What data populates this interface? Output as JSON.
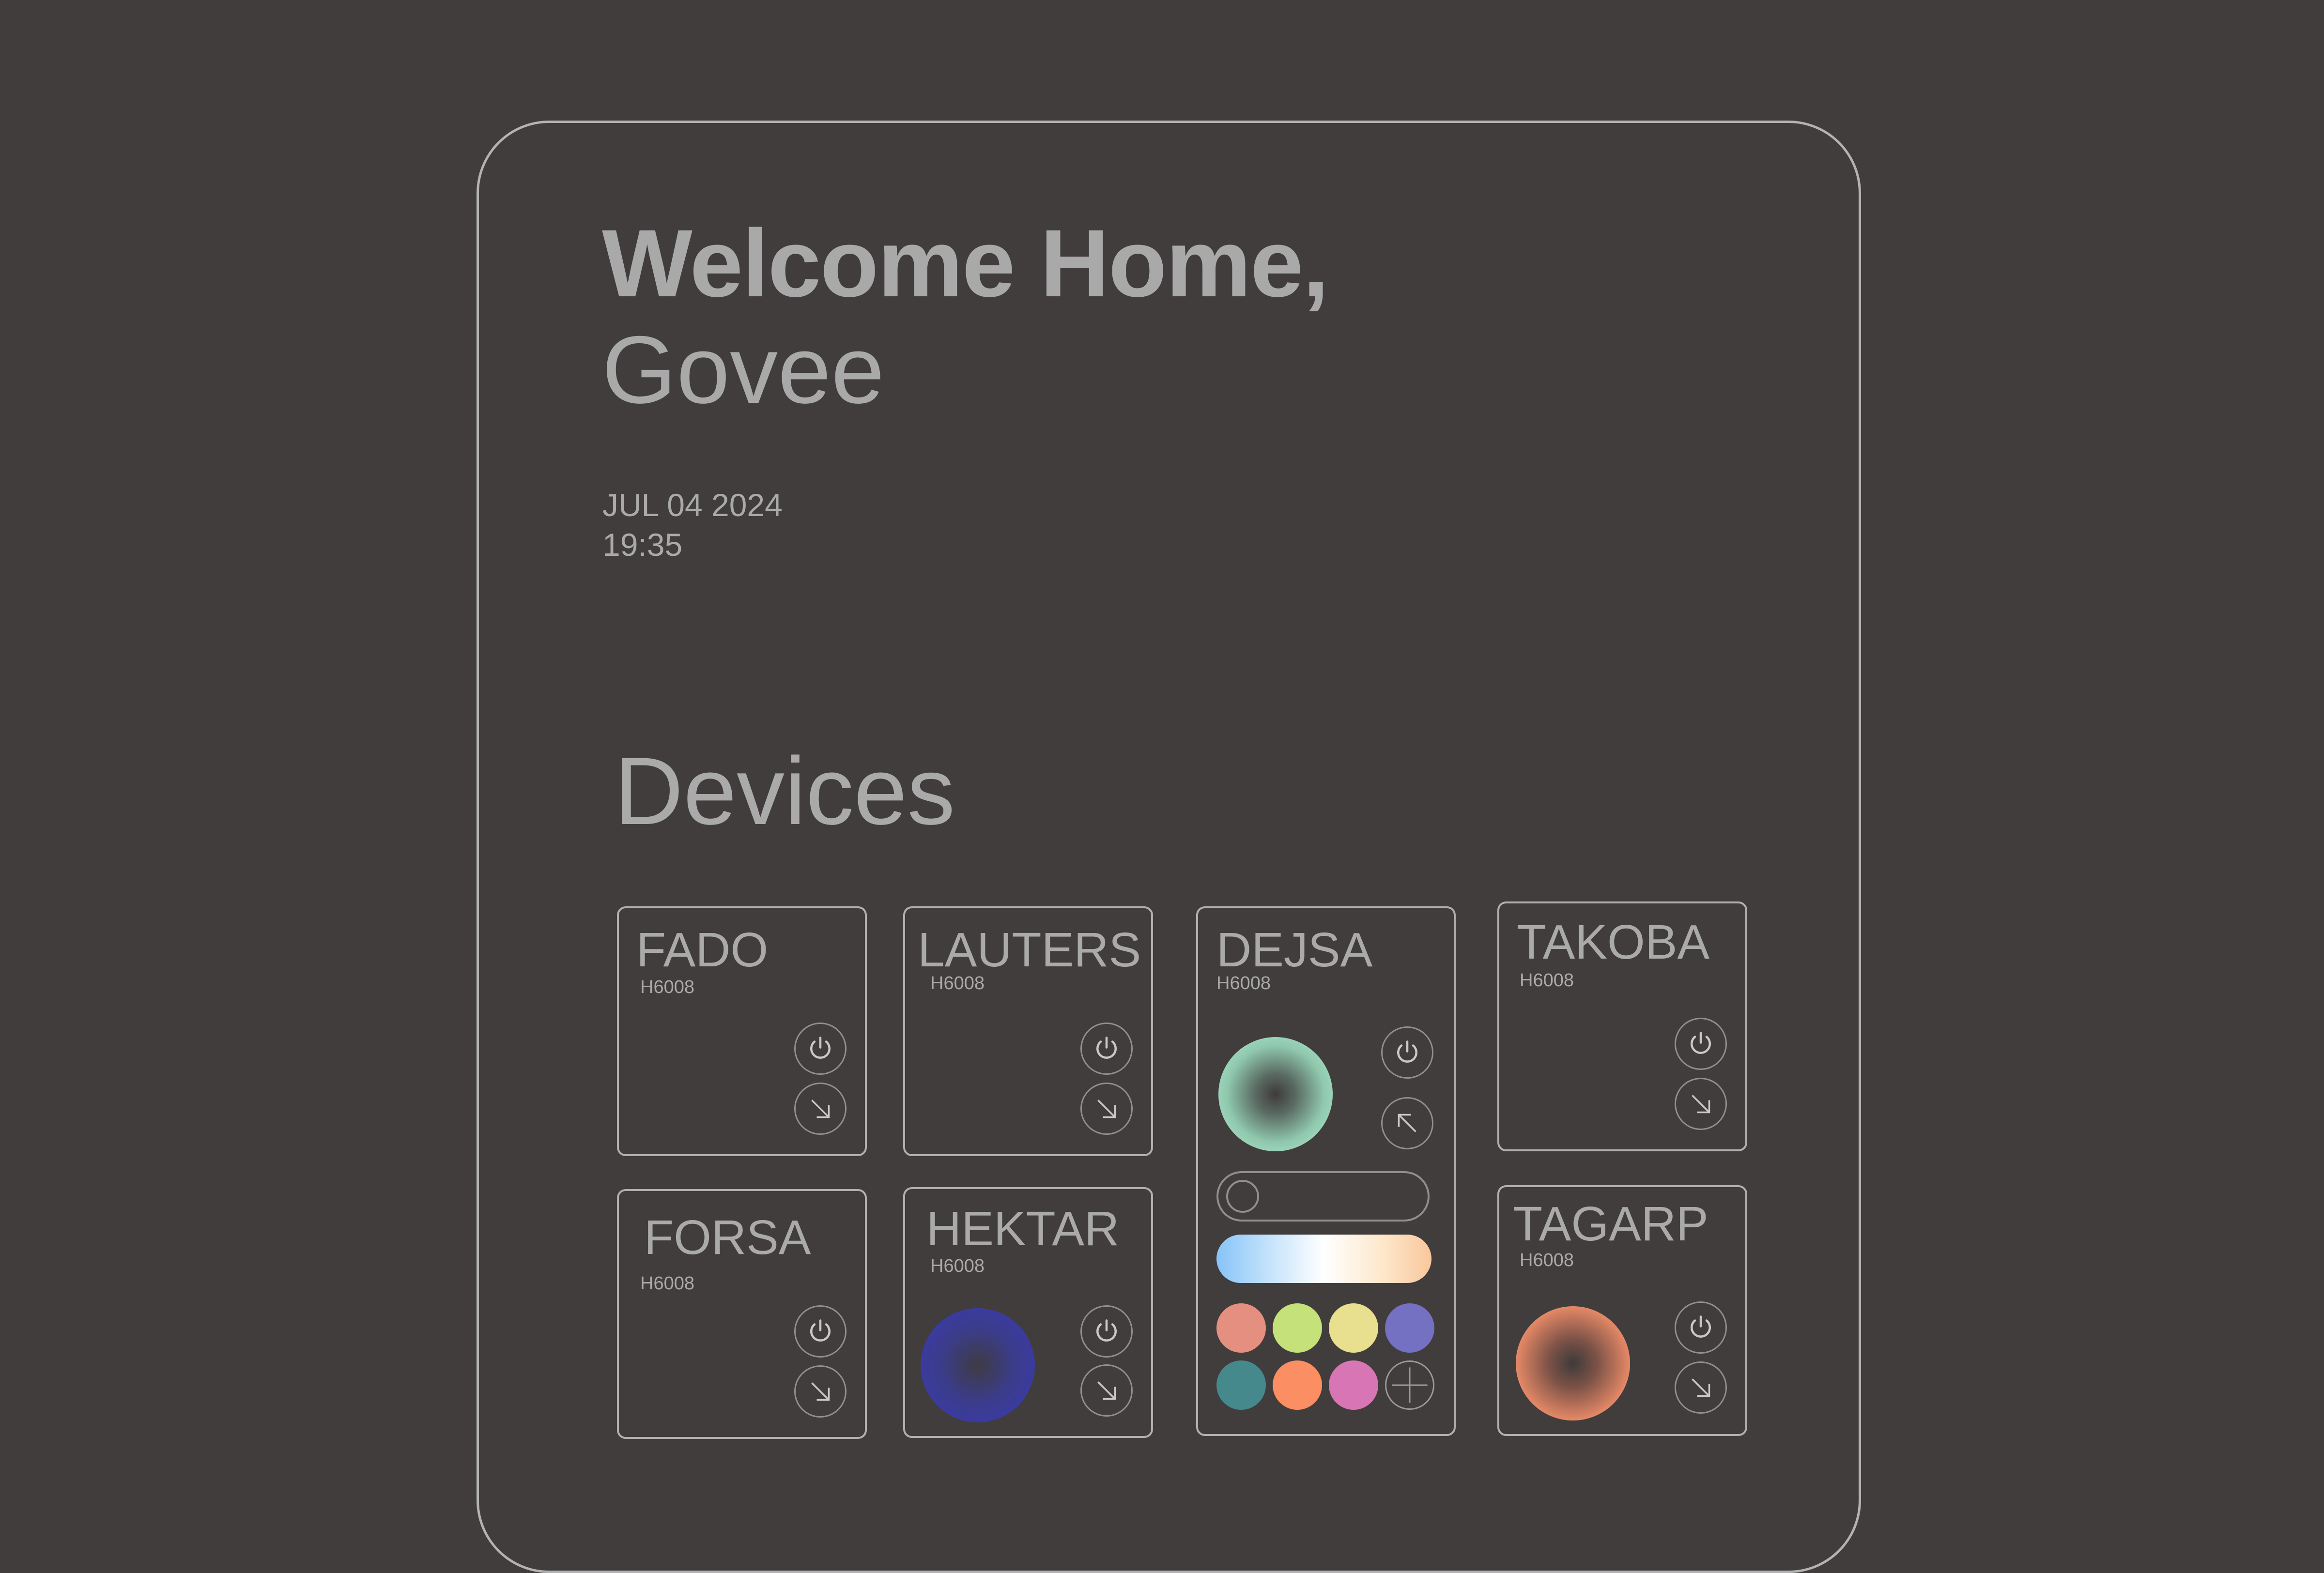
{
  "greeting": {
    "line1": "Welcome Home,",
    "line2": "Govee"
  },
  "datetime": {
    "date": "JUL 04 2024",
    "time": "19:35"
  },
  "devices_title": "Devices",
  "devices": {
    "fado": {
      "name": "FADO",
      "model": "H6008"
    },
    "lauters": {
      "name": "LAUTERS",
      "model": "H6008"
    },
    "dejsa": {
      "name": "DEJSA",
      "model": "H6008",
      "toggle_on": false
    },
    "takoba": {
      "name": "TAKOBA",
      "model": "H6008"
    },
    "forsa": {
      "name": "FORSA",
      "model": "H6008"
    },
    "hektar": {
      "name": "HEKTAR",
      "model": "H6008"
    },
    "tagarp": {
      "name": "TAGARP",
      "model": "H6008"
    }
  },
  "colors": {
    "background": "#403d3c",
    "text": "#a9a9a9",
    "swatches": [
      "#e58f80",
      "#c5e27a",
      "#e9e08f",
      "#7470c2",
      "#46898c",
      "#fb8e63",
      "#d876b5"
    ],
    "gradient": [
      "#86c3f8",
      "#ffffff",
      "#f9c79c"
    ],
    "orbs": {
      "dejsa": "#b6f0d4",
      "hektar": "#3a3ab5",
      "tagarp": "#ff9e7a"
    }
  },
  "icons": {
    "power": "power-icon",
    "expand": "arrow-down-right-icon",
    "collapse": "arrow-up-left-icon",
    "add": "plus-icon"
  }
}
